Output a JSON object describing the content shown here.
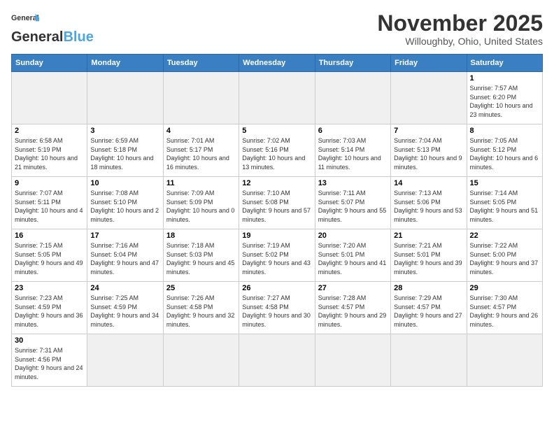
{
  "header": {
    "logo_general": "General",
    "logo_blue": "Blue",
    "month_title": "November 2025",
    "location": "Willoughby, Ohio, United States"
  },
  "weekdays": [
    "Sunday",
    "Monday",
    "Tuesday",
    "Wednesday",
    "Thursday",
    "Friday",
    "Saturday"
  ],
  "weeks": [
    [
      {
        "day": "",
        "info": ""
      },
      {
        "day": "",
        "info": ""
      },
      {
        "day": "",
        "info": ""
      },
      {
        "day": "",
        "info": ""
      },
      {
        "day": "",
        "info": ""
      },
      {
        "day": "",
        "info": ""
      },
      {
        "day": "1",
        "info": "Sunrise: 7:57 AM\nSunset: 6:20 PM\nDaylight: 10 hours and 23 minutes."
      }
    ],
    [
      {
        "day": "2",
        "info": "Sunrise: 6:58 AM\nSunset: 5:19 PM\nDaylight: 10 hours and 21 minutes."
      },
      {
        "day": "3",
        "info": "Sunrise: 6:59 AM\nSunset: 5:18 PM\nDaylight: 10 hours and 18 minutes."
      },
      {
        "day": "4",
        "info": "Sunrise: 7:01 AM\nSunset: 5:17 PM\nDaylight: 10 hours and 16 minutes."
      },
      {
        "day": "5",
        "info": "Sunrise: 7:02 AM\nSunset: 5:16 PM\nDaylight: 10 hours and 13 minutes."
      },
      {
        "day": "6",
        "info": "Sunrise: 7:03 AM\nSunset: 5:14 PM\nDaylight: 10 hours and 11 minutes."
      },
      {
        "day": "7",
        "info": "Sunrise: 7:04 AM\nSunset: 5:13 PM\nDaylight: 10 hours and 9 minutes."
      },
      {
        "day": "8",
        "info": "Sunrise: 7:05 AM\nSunset: 5:12 PM\nDaylight: 10 hours and 6 minutes."
      }
    ],
    [
      {
        "day": "9",
        "info": "Sunrise: 7:07 AM\nSunset: 5:11 PM\nDaylight: 10 hours and 4 minutes."
      },
      {
        "day": "10",
        "info": "Sunrise: 7:08 AM\nSunset: 5:10 PM\nDaylight: 10 hours and 2 minutes."
      },
      {
        "day": "11",
        "info": "Sunrise: 7:09 AM\nSunset: 5:09 PM\nDaylight: 10 hours and 0 minutes."
      },
      {
        "day": "12",
        "info": "Sunrise: 7:10 AM\nSunset: 5:08 PM\nDaylight: 9 hours and 57 minutes."
      },
      {
        "day": "13",
        "info": "Sunrise: 7:11 AM\nSunset: 5:07 PM\nDaylight: 9 hours and 55 minutes."
      },
      {
        "day": "14",
        "info": "Sunrise: 7:13 AM\nSunset: 5:06 PM\nDaylight: 9 hours and 53 minutes."
      },
      {
        "day": "15",
        "info": "Sunrise: 7:14 AM\nSunset: 5:05 PM\nDaylight: 9 hours and 51 minutes."
      }
    ],
    [
      {
        "day": "16",
        "info": "Sunrise: 7:15 AM\nSunset: 5:05 PM\nDaylight: 9 hours and 49 minutes."
      },
      {
        "day": "17",
        "info": "Sunrise: 7:16 AM\nSunset: 5:04 PM\nDaylight: 9 hours and 47 minutes."
      },
      {
        "day": "18",
        "info": "Sunrise: 7:18 AM\nSunset: 5:03 PM\nDaylight: 9 hours and 45 minutes."
      },
      {
        "day": "19",
        "info": "Sunrise: 7:19 AM\nSunset: 5:02 PM\nDaylight: 9 hours and 43 minutes."
      },
      {
        "day": "20",
        "info": "Sunrise: 7:20 AM\nSunset: 5:01 PM\nDaylight: 9 hours and 41 minutes."
      },
      {
        "day": "21",
        "info": "Sunrise: 7:21 AM\nSunset: 5:01 PM\nDaylight: 9 hours and 39 minutes."
      },
      {
        "day": "22",
        "info": "Sunrise: 7:22 AM\nSunset: 5:00 PM\nDaylight: 9 hours and 37 minutes."
      }
    ],
    [
      {
        "day": "23",
        "info": "Sunrise: 7:23 AM\nSunset: 4:59 PM\nDaylight: 9 hours and 36 minutes."
      },
      {
        "day": "24",
        "info": "Sunrise: 7:25 AM\nSunset: 4:59 PM\nDaylight: 9 hours and 34 minutes."
      },
      {
        "day": "25",
        "info": "Sunrise: 7:26 AM\nSunset: 4:58 PM\nDaylight: 9 hours and 32 minutes."
      },
      {
        "day": "26",
        "info": "Sunrise: 7:27 AM\nSunset: 4:58 PM\nDaylight: 9 hours and 30 minutes."
      },
      {
        "day": "27",
        "info": "Sunrise: 7:28 AM\nSunset: 4:57 PM\nDaylight: 9 hours and 29 minutes."
      },
      {
        "day": "28",
        "info": "Sunrise: 7:29 AM\nSunset: 4:57 PM\nDaylight: 9 hours and 27 minutes."
      },
      {
        "day": "29",
        "info": "Sunrise: 7:30 AM\nSunset: 4:57 PM\nDaylight: 9 hours and 26 minutes."
      }
    ],
    [
      {
        "day": "30",
        "info": "Sunrise: 7:31 AM\nSunset: 4:56 PM\nDaylight: 9 hours and 24 minutes."
      },
      {
        "day": "",
        "info": ""
      },
      {
        "day": "",
        "info": ""
      },
      {
        "day": "",
        "info": ""
      },
      {
        "day": "",
        "info": ""
      },
      {
        "day": "",
        "info": ""
      },
      {
        "day": "",
        "info": ""
      }
    ]
  ]
}
